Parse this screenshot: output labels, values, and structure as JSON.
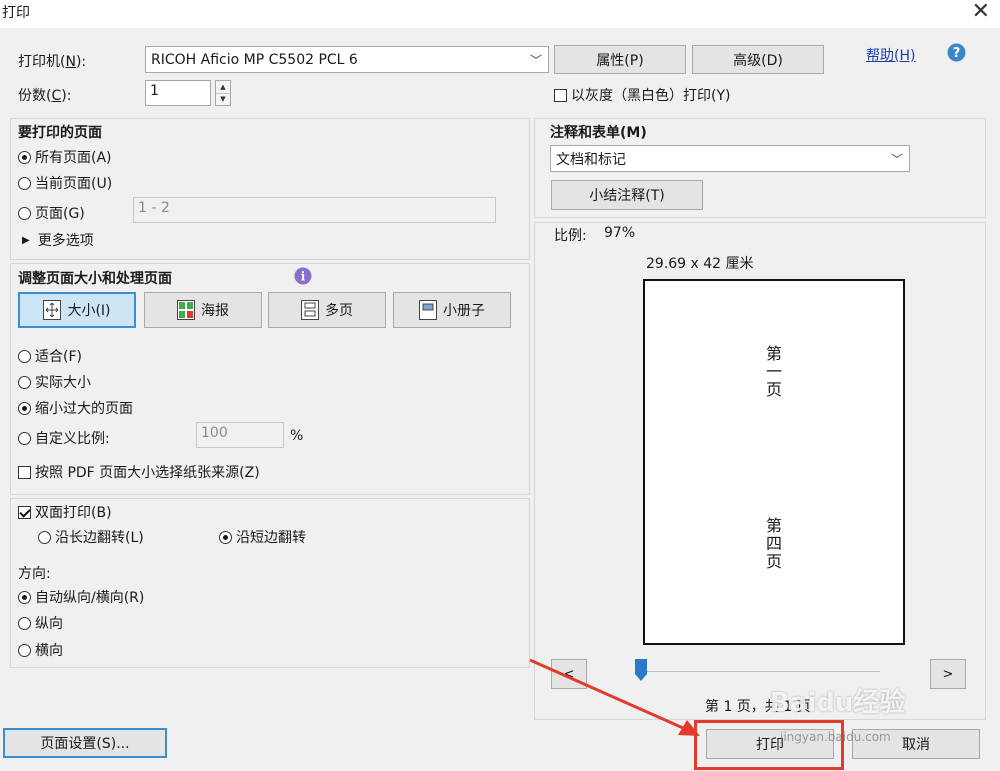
{
  "window": {
    "title": "打印",
    "close_glyph": "✕"
  },
  "printer": {
    "label_prefix": "打印机(",
    "label_key": "N",
    "label_suffix": "):",
    "selected": "RICOH Aficio MP C5502 PCL 6",
    "properties_label": "属性(P)",
    "advanced_label": "高级(D)",
    "help_label": "帮助(H)",
    "copies_label_prefix": "份数(",
    "copies_label_key": "C",
    "copies_label_suffix": "):",
    "copies_value": "1",
    "grayscale_label": "以灰度（黑白色）打印(Y)",
    "grayscale_checked": false
  },
  "pages": {
    "title": "要打印的页面",
    "all_pages": "所有页面(A)",
    "current_page": "当前页面(U)",
    "pages_opt": "页面(G)",
    "pages_range": "1 - 2",
    "more_options": "更多选项",
    "selected": "all"
  },
  "sizing": {
    "title": "调整页面大小和处理页面",
    "modes": [
      {
        "label": "大小(I)",
        "active": true
      },
      {
        "label": "海报",
        "active": false
      },
      {
        "label": "多页",
        "active": false
      },
      {
        "label": "小册子",
        "active": false
      }
    ],
    "fit": "适合(F)",
    "actual_size": "实际大小",
    "shrink": "缩小过大的页面",
    "custom_scale": "自定义比例:",
    "custom_scale_value": "100",
    "percent": "%",
    "paper_source": "按照 PDF 页面大小选择纸张来源(Z)",
    "selected": "shrink"
  },
  "duplex": {
    "label": "双面打印(B)",
    "checked": true,
    "long_edge": "沿长边翻转(L)",
    "short_edge": "沿短边翻转",
    "selected": "short"
  },
  "orientation": {
    "title": "方向:",
    "auto": "自动纵向/横向(R)",
    "portrait": "纵向",
    "landscape": "横向",
    "selected": "auto"
  },
  "comments": {
    "title": "注释和表单(M)",
    "selected": "文档和标记",
    "summarize_label": "小结注释(T)"
  },
  "preview": {
    "scale_label": "比例:",
    "scale_value": "97%",
    "dimensions": "29.69 x 42 厘米",
    "page_top_text": "第一页",
    "page_bottom_text": "第四页",
    "prev": "<",
    "next": ">",
    "page_counter": "第 1 页，共 1 页"
  },
  "footer": {
    "page_setup": "页面设置(S)...",
    "print": "打印",
    "cancel": "取消"
  },
  "watermark": {
    "text": "Baidu经验",
    "url": "jingyan.baidu.com"
  },
  "colors": {
    "accent_blue": "#3a8fd0",
    "annotation_red": "#e23b2e",
    "slider_blue": "#2b78c5"
  },
  "icons": {
    "help": "help-icon",
    "info": "info-icon",
    "more_options": "triangle-right-icon",
    "dropdown": "chevron-down-icon"
  }
}
